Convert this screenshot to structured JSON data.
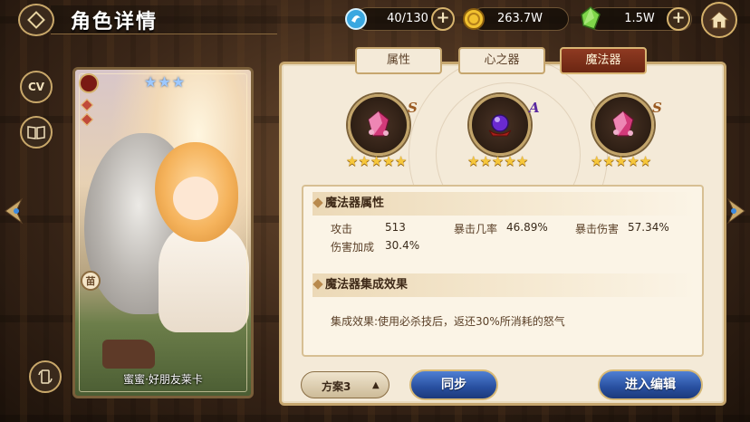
{
  "header": {
    "title": "角色详情",
    "stamina": "40/130",
    "gold": "263.7W",
    "gems": "1.5W"
  },
  "side": {
    "cv_label": "CV"
  },
  "card": {
    "name": "蜜蜜·好朋友莱卡",
    "stars": 3,
    "badge": "苗"
  },
  "tabs": [
    {
      "label": "属性",
      "active": false
    },
    {
      "label": "心之器",
      "active": false
    },
    {
      "label": "魔法器",
      "active": true
    }
  ],
  "artifacts": [
    {
      "grade": "S",
      "stars": 5,
      "gem": "pink-crystal-icon"
    },
    {
      "grade": "A",
      "stars": 5,
      "gem": "purple-orb-icon"
    },
    {
      "grade": "S",
      "stars": 5,
      "gem": "pink-crystal-icon"
    }
  ],
  "attributes": {
    "section_title": "魔法器属性",
    "stats": [
      {
        "label": "攻击",
        "value": "513"
      },
      {
        "label": "暴击几率",
        "value": "46.89%"
      },
      {
        "label": "暴击伤害",
        "value": "57.34%"
      },
      {
        "label": "伤害加成",
        "value": "30.4%"
      }
    ]
  },
  "set_effect": {
    "section_title": "魔法器集成效果",
    "text": "集成效果:使用必杀技后，返还30%所消耗的怒气"
  },
  "footer": {
    "plan": "方案3",
    "sync": "同步",
    "edit": "进入编辑"
  },
  "colors": {
    "panel_bg": "#f4ead8",
    "gold_border": "#c6a66e",
    "active_tab": "#8f3a22",
    "blue_button": "#284f9f",
    "star": "#f7c73a"
  }
}
